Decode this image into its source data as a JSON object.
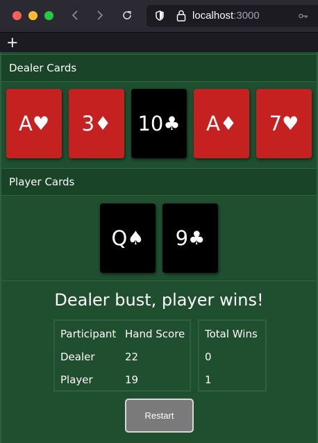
{
  "browser": {
    "url_host": "localhost",
    "url_port": ":3000"
  },
  "dealer": {
    "header": "Dealer Cards",
    "cards": [
      {
        "rank": "A",
        "suit": "♥",
        "color": "red"
      },
      {
        "rank": "3",
        "suit": "♦",
        "color": "red"
      },
      {
        "rank": "10",
        "suit": "♣",
        "color": "black"
      },
      {
        "rank": "A",
        "suit": "♦",
        "color": "red"
      },
      {
        "rank": "7",
        "suit": "♥",
        "color": "red"
      }
    ]
  },
  "player": {
    "header": "Player Cards",
    "cards": [
      {
        "rank": "Q",
        "suit": "♠",
        "color": "black"
      },
      {
        "rank": "9",
        "suit": "♣",
        "color": "black"
      }
    ]
  },
  "result": {
    "message": "Dealer bust, player wins!"
  },
  "scoreboard": {
    "headers": {
      "participant": "Participant",
      "hand_score": "Hand Score",
      "total_wins": "Total Wins"
    },
    "rows": [
      {
        "participant": "Dealer",
        "hand_score": "22",
        "total_wins": "0"
      },
      {
        "participant": "Player",
        "hand_score": "19",
        "total_wins": "1"
      }
    ]
  },
  "restart_label": "Restart",
  "colors": {
    "table_green": "#1f4f2f",
    "card_red": "#c52121",
    "card_black": "#000000"
  }
}
